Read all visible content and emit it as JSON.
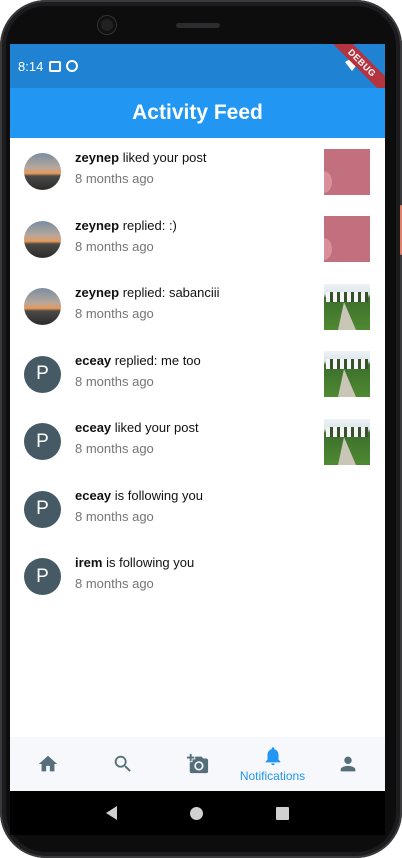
{
  "status_bar": {
    "time": "8:14",
    "debug_ribbon": "DEBUG"
  },
  "app_bar": {
    "title": "Activity Feed"
  },
  "feed": [
    {
      "username": "zeynep",
      "action": " liked your post",
      "time": "8 months ago",
      "avatar": "photo",
      "thumb": "pink"
    },
    {
      "username": "zeynep",
      "action": " replied: :)",
      "time": "8 months ago",
      "avatar": "photo",
      "thumb": "pink"
    },
    {
      "username": "zeynep",
      "action": " replied: sabanciii",
      "time": "8 months ago",
      "avatar": "photo",
      "thumb": "garden"
    },
    {
      "username": "eceay",
      "action": " replied: me too",
      "time": "8 months ago",
      "avatar": "P",
      "thumb": "garden"
    },
    {
      "username": "eceay",
      "action": " liked your post",
      "time": "8 months ago",
      "avatar": "P",
      "thumb": "garden"
    },
    {
      "username": "eceay",
      "action": " is following you",
      "time": "8 months ago",
      "avatar": "P",
      "thumb": ""
    },
    {
      "username": "irem",
      "action": " is following you",
      "time": "8 months ago",
      "avatar": "P",
      "thumb": ""
    }
  ],
  "bottom_nav": {
    "items": [
      {
        "icon": "home-icon"
      },
      {
        "icon": "search-icon"
      },
      {
        "icon": "add-photo-icon"
      },
      {
        "icon": "notifications-icon",
        "label": "Notifications",
        "active": true
      },
      {
        "icon": "person-icon"
      }
    ]
  },
  "colors": {
    "primary": "#2196f3",
    "status_bar": "#1f82d2",
    "avatar_bg": "#455a64"
  }
}
